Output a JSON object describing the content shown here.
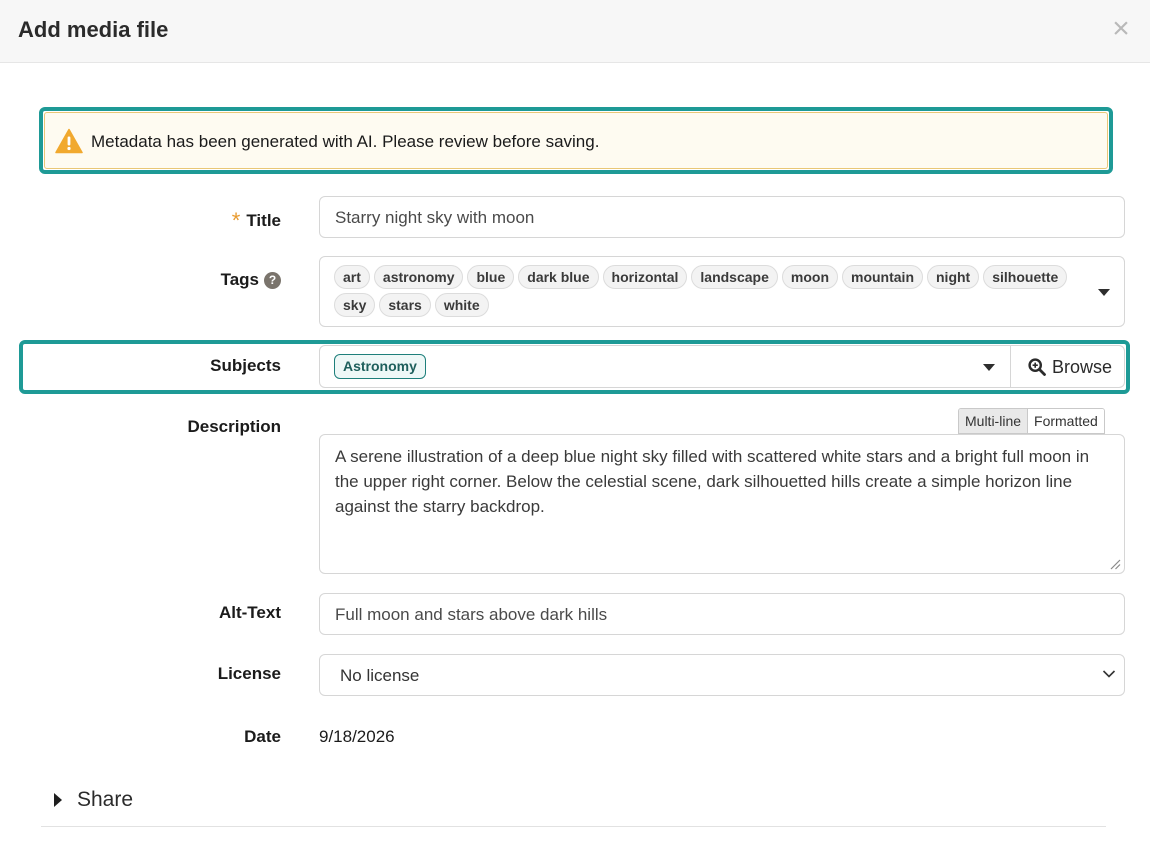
{
  "dialog": {
    "title": "Add media file",
    "close_label": "×"
  },
  "notice": {
    "text": "Metadata has been generated with AI. Please review before saving."
  },
  "form": {
    "title": {
      "label": "Title",
      "required_mark": "*",
      "value": "Starry night sky with moon"
    },
    "tags": {
      "label": "Tags",
      "help_icon": "?",
      "items": [
        "art",
        "astronomy",
        "blue",
        "dark blue",
        "horizontal",
        "landscape",
        "moon",
        "mountain",
        "night",
        "silhouette",
        "sky",
        "stars",
        "white"
      ]
    },
    "subjects": {
      "label": "Subjects",
      "selected": "Astronomy",
      "browse_label": "Browse"
    },
    "description": {
      "label": "Description",
      "modes": [
        "Multi-line",
        "Formatted"
      ],
      "active_mode": "Multi-line",
      "value": "A serene illustration of a deep blue night sky filled with scattered white stars and a bright full moon in the upper right corner. Below the celestial scene, dark silhouetted hills create a simple horizon line against the starry backdrop."
    },
    "alt_text": {
      "label": "Alt-Text",
      "value": "Full moon and stars above dark hills"
    },
    "license": {
      "label": "License",
      "value": "No license"
    },
    "date": {
      "label": "Date",
      "value": "9/18/2026"
    }
  },
  "share": {
    "label": "Share"
  },
  "colors": {
    "highlight": "#1e9a96",
    "warning": "#f1a92f",
    "required": "#e89a2e"
  }
}
